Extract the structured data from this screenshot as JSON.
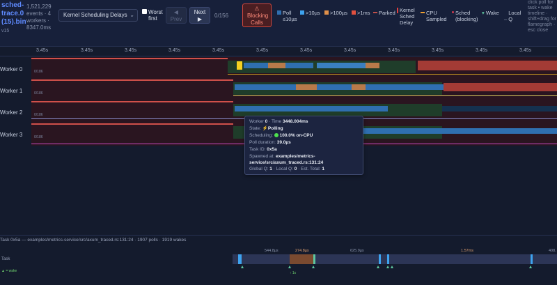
{
  "file": {
    "name": "sched-trace.0 (15).bin",
    "version": "v15"
  },
  "stats": {
    "text": "1,521,229 events · 4 workers · 8347.0ms"
  },
  "view_select": {
    "value": "Kernel Scheduling Delays"
  },
  "worst_first": {
    "label": "Worst first",
    "checked": false
  },
  "nav": {
    "prev_label": "Prev",
    "next_label": "Next",
    "counter": "0/156"
  },
  "blocking": {
    "label": "Blocking Calls"
  },
  "legend": [
    {
      "label": "Poll ≤10µs",
      "color": "#2f6fb0"
    },
    {
      "label": ">10µs",
      "color": "#3ea3ef"
    },
    {
      "label": ">100µs",
      "color": "#e0904a"
    },
    {
      "label": ">1ms",
      "color": "#e0503f"
    },
    {
      "label": "Parked",
      "color": "#c0504a"
    },
    {
      "label": "Kernel Sched Delay",
      "color": "#e04040"
    },
    {
      "label": "CPU Sampled",
      "color": "#f0a030"
    },
    {
      "label": "Sched (blocking)",
      "color": "#d03a50"
    },
    {
      "label": "Wake",
      "color": "#5ec7a0"
    },
    {
      "label": "Local Q",
      "color": "#9aa3ba"
    }
  ],
  "hint": "click poll for task • wake timeline · shift+drag for flamegraph · esc close",
  "axis_ticks": [
    "3.45s",
    "3.45s",
    "3.45s",
    "3.45s",
    "3.45s",
    "3.45s",
    "3.45s",
    "3.45s",
    "3.45s",
    "3.45s",
    "3.45s",
    "3.45s"
  ],
  "workers": [
    {
      "label": "Worker 0",
      "mark": "0/186"
    },
    {
      "label": "Worker 1",
      "mark": "0/186"
    },
    {
      "label": "Worker 2",
      "mark": "0/186"
    },
    {
      "label": "Worker 3",
      "mark": "0/186"
    }
  ],
  "tooltip": {
    "worker_label": "Worker",
    "worker_value": "0",
    "time_label": "Time",
    "time_value": "3448.004ms",
    "state_label": "State:",
    "state_value": "⚡Polling",
    "scheduling_label": "Scheduling:",
    "scheduling_value": "100.0% on-CPU",
    "poll_duration_label": "Poll duration:",
    "poll_duration_value": "39.0µs",
    "task_id_label": "Task ID:",
    "task_id_value": "0x5a",
    "spawned_label": "Spawned at:",
    "spawned_value": "examples/metrics-service/src/axum_traced.rs:131:24",
    "global_q_label": "Global Q:",
    "global_q_value": "1",
    "local_q_label": "Local Q:",
    "local_q_value": "0",
    "est_total_label": "Est. Total:",
    "est_total_value": "1"
  },
  "task_panel": {
    "title": "Task 0x5a — examples/metrics-service/src/axum_traced.rs:131:24 · 1907 polls · 1919 wakes",
    "lane_label": "Task",
    "wake_label": "▲ = wake",
    "durations": [
      "544.8µs",
      "274.8µs",
      "625.9µs",
      "1.57ms",
      "408."
    ],
    "footnote": "↑ 1x"
  }
}
